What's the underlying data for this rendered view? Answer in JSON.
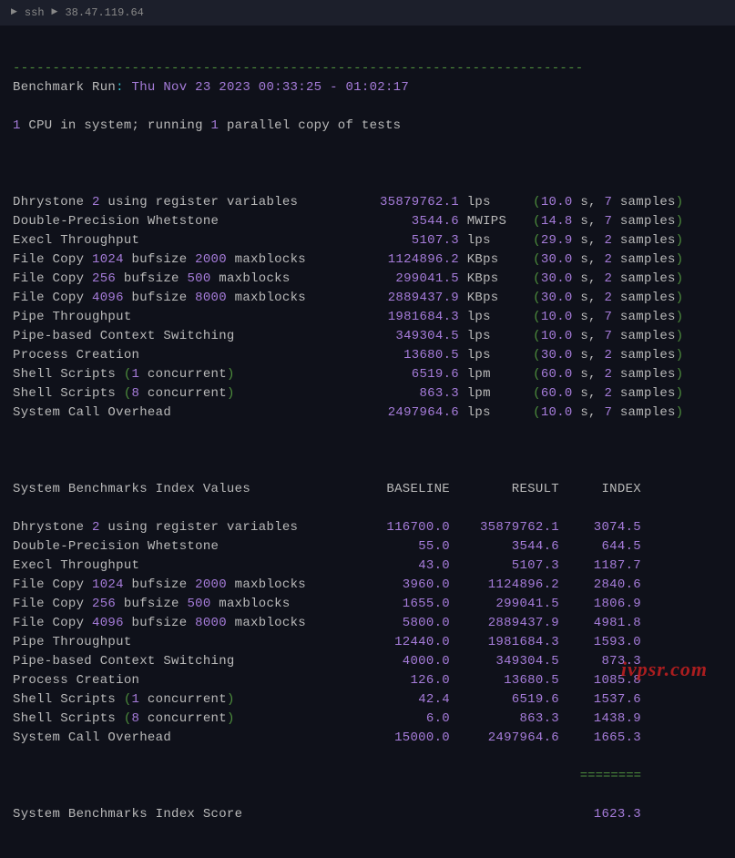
{
  "titlebar": {
    "prefix": "ssh",
    "host": "38.47.119.64"
  },
  "header": {
    "run_label": "Benchmark Run",
    "run_time": "Thu Nov 23 2023 00:33:25 - 01:02:17",
    "cpu_count": "1",
    "cpu_text1": " CPU in system; running ",
    "parallel_count": "1",
    "cpu_text2": " parallel copy of tests"
  },
  "tests": [
    {
      "name_parts": [
        {
          "t": "Dhrystone ",
          "c": "label"
        },
        {
          "t": "2",
          "c": "purple"
        },
        {
          "t": " using register variables",
          "c": "label"
        }
      ],
      "value": "35879762.1",
      "unit": "lps",
      "time": "10.0",
      "samples": "7"
    },
    {
      "name_parts": [
        {
          "t": "Double-Precision Whetstone",
          "c": "label"
        }
      ],
      "value": "3544.6",
      "unit": "MWIPS",
      "time": "14.8",
      "samples": "7"
    },
    {
      "name_parts": [
        {
          "t": "Execl Throughput",
          "c": "label"
        }
      ],
      "value": "5107.3",
      "unit": "lps",
      "time": "29.9",
      "samples": "2"
    },
    {
      "name_parts": [
        {
          "t": "File Copy ",
          "c": "label"
        },
        {
          "t": "1024",
          "c": "purple"
        },
        {
          "t": " bufsize ",
          "c": "label"
        },
        {
          "t": "2000",
          "c": "purple"
        },
        {
          "t": " maxblocks",
          "c": "label"
        }
      ],
      "value": "1124896.2",
      "unit": "KBps",
      "time": "30.0",
      "samples": "2"
    },
    {
      "name_parts": [
        {
          "t": "File Copy ",
          "c": "label"
        },
        {
          "t": "256",
          "c": "purple"
        },
        {
          "t": " bufsize ",
          "c": "label"
        },
        {
          "t": "500",
          "c": "purple"
        },
        {
          "t": " maxblocks",
          "c": "label"
        }
      ],
      "value": "299041.5",
      "unit": "KBps",
      "time": "30.0",
      "samples": "2"
    },
    {
      "name_parts": [
        {
          "t": "File Copy ",
          "c": "label"
        },
        {
          "t": "4096",
          "c": "purple"
        },
        {
          "t": " bufsize ",
          "c": "label"
        },
        {
          "t": "8000",
          "c": "purple"
        },
        {
          "t": " maxblocks",
          "c": "label"
        }
      ],
      "value": "2889437.9",
      "unit": "KBps",
      "time": "30.0",
      "samples": "2"
    },
    {
      "name_parts": [
        {
          "t": "Pipe Throughput",
          "c": "label"
        }
      ],
      "value": "1981684.3",
      "unit": "lps",
      "time": "10.0",
      "samples": "7"
    },
    {
      "name_parts": [
        {
          "t": "Pipe-based Context Switching",
          "c": "label"
        }
      ],
      "value": "349304.5",
      "unit": "lps",
      "time": "10.0",
      "samples": "7"
    },
    {
      "name_parts": [
        {
          "t": "Process Creation",
          "c": "label"
        }
      ],
      "value": "13680.5",
      "unit": "lps",
      "time": "30.0",
      "samples": "2"
    },
    {
      "name_parts": [
        {
          "t": "Shell Scripts ",
          "c": "label"
        },
        {
          "t": "(",
          "c": "green"
        },
        {
          "t": "1",
          "c": "purple"
        },
        {
          "t": " concurrent",
          "c": "label"
        },
        {
          "t": ")",
          "c": "green"
        }
      ],
      "value": "6519.6",
      "unit": "lpm",
      "time": "60.0",
      "samples": "2"
    },
    {
      "name_parts": [
        {
          "t": "Shell Scripts ",
          "c": "label"
        },
        {
          "t": "(",
          "c": "green"
        },
        {
          "t": "8",
          "c": "purple"
        },
        {
          "t": " concurrent",
          "c": "label"
        },
        {
          "t": ")",
          "c": "green"
        }
      ],
      "value": "863.3",
      "unit": "lpm",
      "time": "60.0",
      "samples": "2"
    },
    {
      "name_parts": [
        {
          "t": "System Call Overhead",
          "c": "label"
        }
      ],
      "value": "2497964.6",
      "unit": "lps",
      "time": "10.0",
      "samples": "7"
    }
  ],
  "index_header": {
    "title": "System Benchmarks Index Values",
    "c1": "BASELINE",
    "c2": "RESULT",
    "c3": "INDEX"
  },
  "index_rows": [
    {
      "name_parts": [
        {
          "t": "Dhrystone ",
          "c": "label"
        },
        {
          "t": "2",
          "c": "purple"
        },
        {
          "t": " using register variables",
          "c": "label"
        }
      ],
      "baseline": "116700.0",
      "result": "35879762.1",
      "index": "3074.5"
    },
    {
      "name_parts": [
        {
          "t": "Double-Precision Whetstone",
          "c": "label"
        }
      ],
      "baseline": "55.0",
      "result": "3544.6",
      "index": "644.5"
    },
    {
      "name_parts": [
        {
          "t": "Execl Throughput",
          "c": "label"
        }
      ],
      "baseline": "43.0",
      "result": "5107.3",
      "index": "1187.7"
    },
    {
      "name_parts": [
        {
          "t": "File Copy ",
          "c": "label"
        },
        {
          "t": "1024",
          "c": "purple"
        },
        {
          "t": " bufsize ",
          "c": "label"
        },
        {
          "t": "2000",
          "c": "purple"
        },
        {
          "t": " maxblocks",
          "c": "label"
        }
      ],
      "baseline": "3960.0",
      "result": "1124896.2",
      "index": "2840.6"
    },
    {
      "name_parts": [
        {
          "t": "File Copy ",
          "c": "label"
        },
        {
          "t": "256",
          "c": "purple"
        },
        {
          "t": " bufsize ",
          "c": "label"
        },
        {
          "t": "500",
          "c": "purple"
        },
        {
          "t": " maxblocks",
          "c": "label"
        }
      ],
      "baseline": "1655.0",
      "result": "299041.5",
      "index": "1806.9"
    },
    {
      "name_parts": [
        {
          "t": "File Copy ",
          "c": "label"
        },
        {
          "t": "4096",
          "c": "purple"
        },
        {
          "t": " bufsize ",
          "c": "label"
        },
        {
          "t": "8000",
          "c": "purple"
        },
        {
          "t": " maxblocks",
          "c": "label"
        }
      ],
      "baseline": "5800.0",
      "result": "2889437.9",
      "index": "4981.8"
    },
    {
      "name_parts": [
        {
          "t": "Pipe Throughput",
          "c": "label"
        }
      ],
      "baseline": "12440.0",
      "result": "1981684.3",
      "index": "1593.0"
    },
    {
      "name_parts": [
        {
          "t": "Pipe-based Context Switching",
          "c": "label"
        }
      ],
      "baseline": "4000.0",
      "result": "349304.5",
      "index": "873.3"
    },
    {
      "name_parts": [
        {
          "t": "Process Creation",
          "c": "label"
        }
      ],
      "baseline": "126.0",
      "result": "13680.5",
      "index": "1085.8"
    },
    {
      "name_parts": [
        {
          "t": "Shell Scripts ",
          "c": "label"
        },
        {
          "t": "(",
          "c": "green"
        },
        {
          "t": "1",
          "c": "purple"
        },
        {
          "t": " concurrent",
          "c": "label"
        },
        {
          "t": ")",
          "c": "green"
        }
      ],
      "baseline": "42.4",
      "result": "6519.6",
      "index": "1537.6"
    },
    {
      "name_parts": [
        {
          "t": "Shell Scripts ",
          "c": "label"
        },
        {
          "t": "(",
          "c": "green"
        },
        {
          "t": "8",
          "c": "purple"
        },
        {
          "t": " concurrent",
          "c": "label"
        },
        {
          "t": ")",
          "c": "green"
        }
      ],
      "baseline": "6.0",
      "result": "863.3",
      "index": "1438.9"
    },
    {
      "name_parts": [
        {
          "t": "System Call Overhead",
          "c": "label"
        }
      ],
      "baseline": "15000.0",
      "result": "2497964.6",
      "index": "1665.3"
    }
  ],
  "final": {
    "label": "System Benchmarks Index Score",
    "score": "1623.3"
  },
  "watermark": "ivpsr.com",
  "strings": {
    "s_open": " s, ",
    "samples_close": " samples",
    "paren_open": "(",
    "paren_close": ")"
  }
}
